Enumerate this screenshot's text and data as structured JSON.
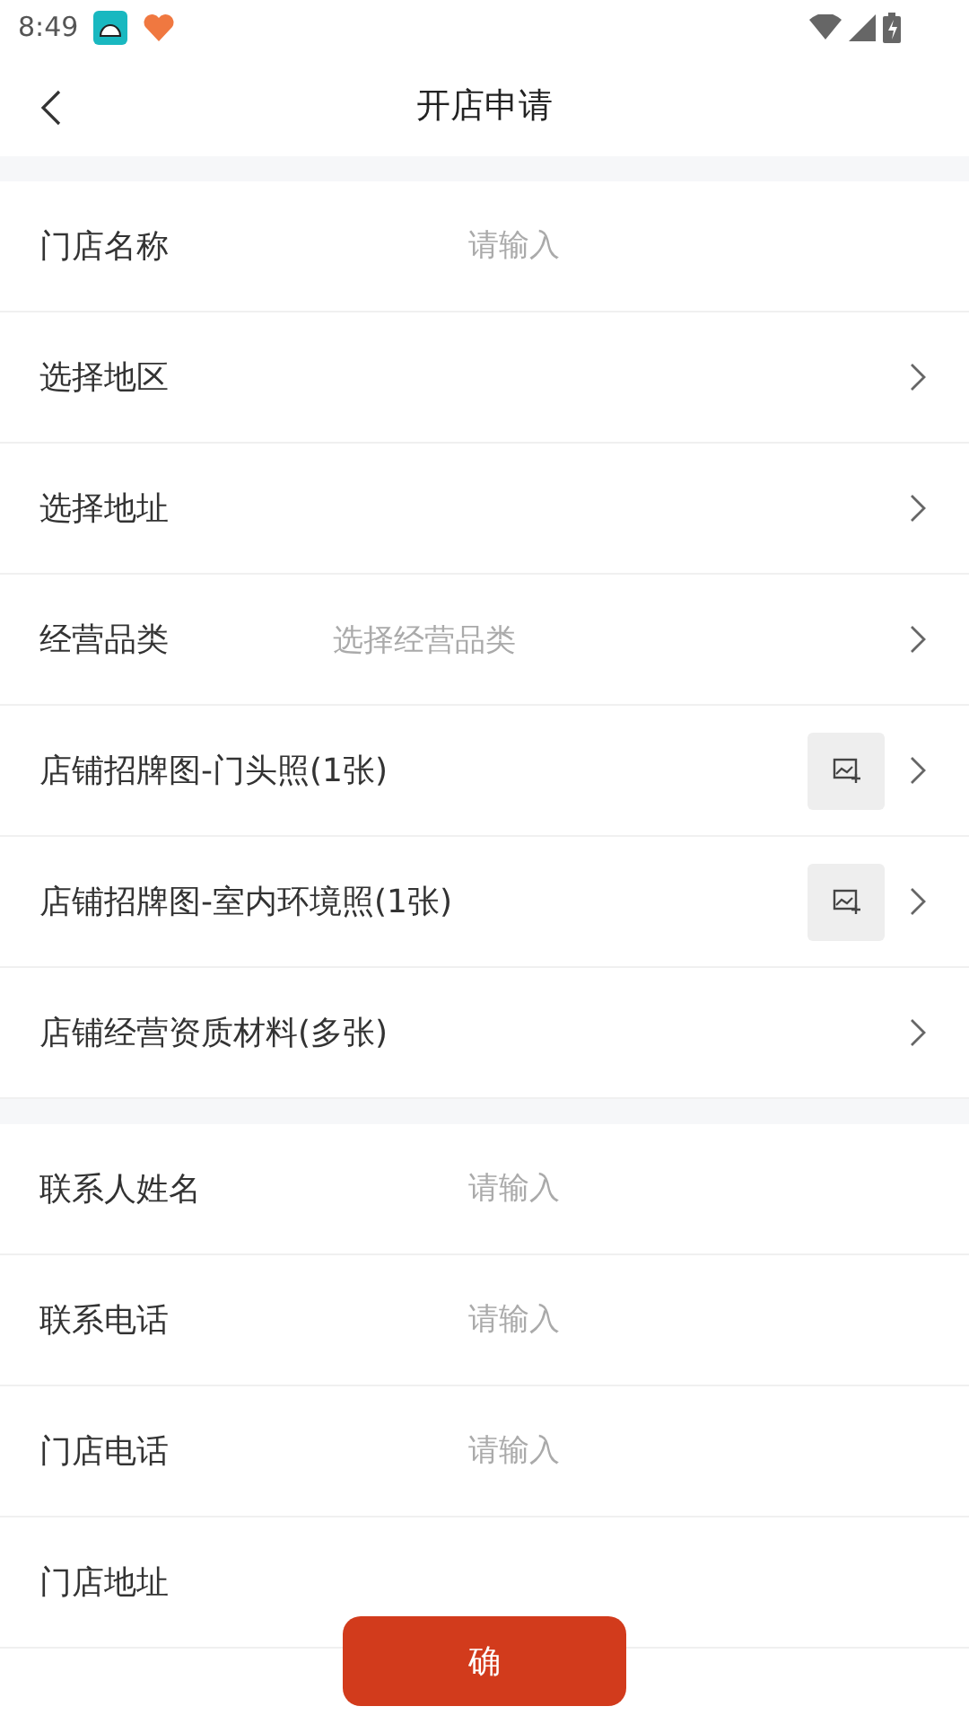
{
  "status_bar": {
    "time": "8:49"
  },
  "header": {
    "title": "开店申请"
  },
  "sections": [
    {
      "rows": [
        {
          "kind": "input",
          "label": "门店名称",
          "placeholder": "请输入"
        },
        {
          "kind": "select",
          "label": "选择地区"
        },
        {
          "kind": "select",
          "label": "选择地址"
        },
        {
          "kind": "select",
          "label": "经营品类",
          "placeholder": "选择经营品类"
        },
        {
          "kind": "photo",
          "label": "店铺招牌图-门头照(1张)"
        },
        {
          "kind": "photo",
          "label": "店铺招牌图-室内环境照(1张)"
        },
        {
          "kind": "select",
          "label": "店铺经营资质材料(多张)"
        }
      ]
    },
    {
      "rows": [
        {
          "kind": "input",
          "label": "联系人姓名",
          "placeholder": "请输入"
        },
        {
          "kind": "input",
          "label": "联系电话",
          "placeholder": "请输入"
        },
        {
          "kind": "input",
          "label": "门店电话",
          "placeholder": "请输入"
        },
        {
          "kind": "input",
          "label": "门店地址"
        }
      ]
    }
  ],
  "submit_button": {
    "label": "确"
  }
}
